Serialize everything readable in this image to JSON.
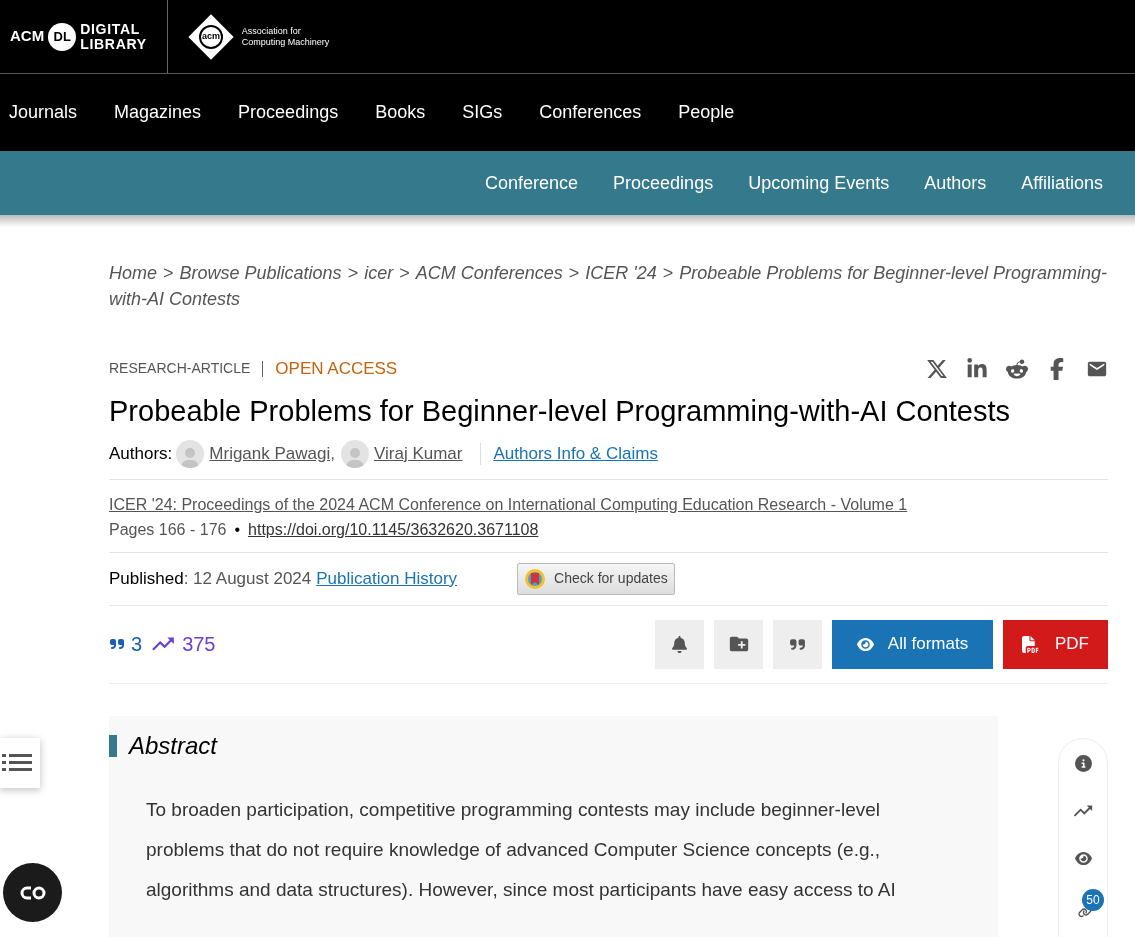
{
  "header": {
    "dl_logo": {
      "acm": "ACM",
      "dl": "DL",
      "line1": "DIGITAL",
      "line2": "LIBRARY"
    },
    "acm_logo": {
      "mark": "acm",
      "line1": "Association for",
      "line2": "Computing Machinery"
    }
  },
  "main_nav": [
    "Journals",
    "Magazines",
    "Proceedings",
    "Books",
    "SIGs",
    "Conferences",
    "People"
  ],
  "sub_nav": [
    "Conference",
    "Proceedings",
    "Upcoming Events",
    "Authors",
    "Affiliations"
  ],
  "breadcrumb": {
    "separator": ">",
    "items": [
      "Home",
      "Browse Publications",
      "icer",
      "ACM Conferences",
      "ICER '24",
      "Probeable Problems for Beginner-level Programming-with-AI Contests"
    ]
  },
  "article": {
    "type": "RESEARCH-ARTICLE",
    "access": "OPEN ACCESS",
    "title": "Probeable Problems for Beginner-level Programming-with-AI Contests",
    "authors_label": "Authors:",
    "authors": [
      "Mrigank Pawagi,",
      "Viraj Kumar"
    ],
    "authors_info": "Authors Info & Claims",
    "proceedings": "ICER '24: Proceedings of the 2024 ACM Conference on International Computing Education Research - Volume 1",
    "pages": "Pages 166 - 176",
    "bullet": "•",
    "doi": "https://doi.org/10.1145/3632620.3671108",
    "published_label": "Published",
    "published_date": ": 12 August 2024",
    "publication_history": "Publication History",
    "check_updates": "Check for updates",
    "citations": "3",
    "downloads": "375",
    "all_formats": "All formats",
    "pdf": "PDF"
  },
  "abstract": {
    "heading": "Abstract",
    "text": "To broaden participation, competitive programming contests may include beginner-level problems that do not require knowledge of advanced Computer Science concepts (e.g., algorithms and data structures). However, since most participants have easy access to AI"
  },
  "side_badge": "50"
}
